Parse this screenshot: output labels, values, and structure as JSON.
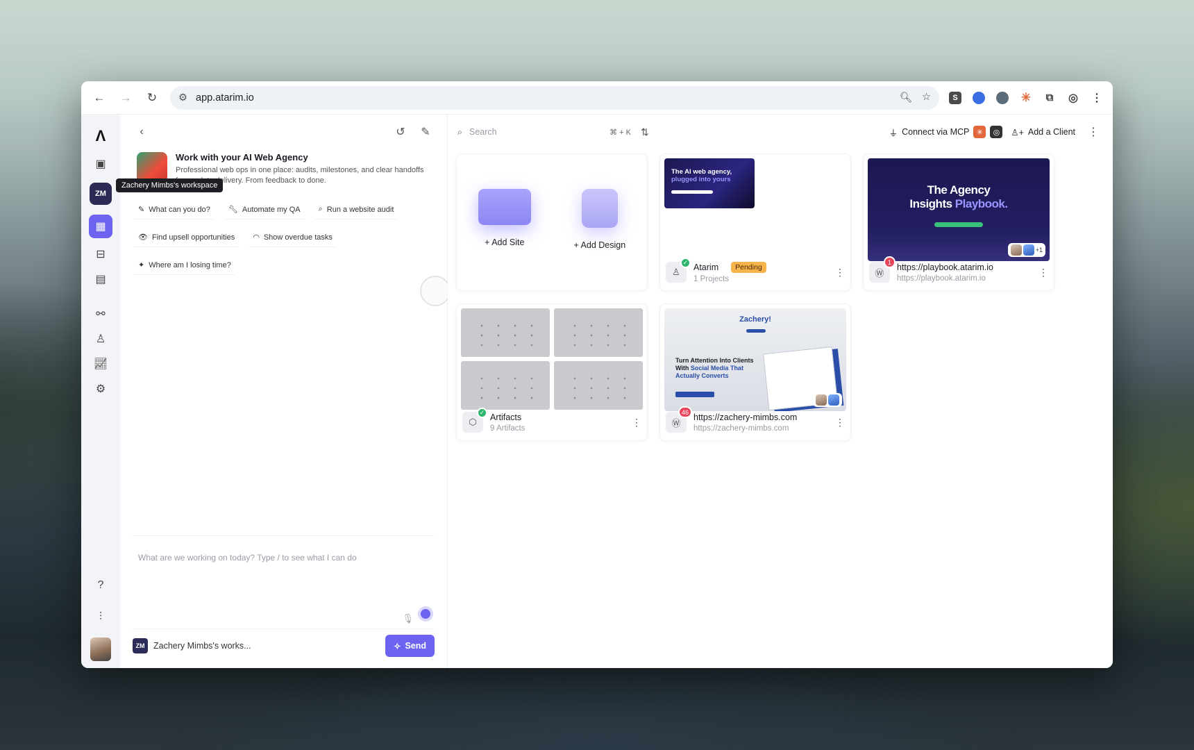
{
  "browser": {
    "url": "app.atarim.io",
    "extensions": [
      {
        "icon": "s-extension-icon",
        "label": "S",
        "color": "#4a4a4a"
      },
      {
        "icon": "blue-circle-extension-icon",
        "label": "",
        "color": "#3b6ee0"
      },
      {
        "icon": "shield-extension-icon",
        "label": "",
        "color": "#5a6b7a"
      },
      {
        "icon": "asterisk-extension-icon",
        "label": "",
        "color": "#e2683c"
      }
    ]
  },
  "rail": {
    "logo": "Λ",
    "workspace_initials": "ZM",
    "workspace_tooltip": "Zachery Mimbs's workspace"
  },
  "chat": {
    "intro_title": "Work with your AI Web Agency",
    "intro_sub_1": "Professional web ops in one place: audits, milestones, and clear handoffs",
    "intro_sub_2": "from ask to delivery. From feedback to done.",
    "suggestions": [
      "What can you do?",
      "Automate my QA",
      "Run a website audit",
      "Find upsell opportunities",
      "Show overdue tasks",
      "Where am I losing time?"
    ],
    "composer_placeholder": "What are we working on today? Type / to see what I can do",
    "workspace_chip": "ZM",
    "workspace_name": "Zachery Mimbs's works...",
    "send_label": "Send"
  },
  "topbar": {
    "search_placeholder": "Search",
    "search_shortcut": "⌘ + K",
    "connect_mcp": "Connect via MCP",
    "add_client": "Add a Client"
  },
  "cards": {
    "add_site": "Add Site",
    "add_design": "Add Design",
    "atarim": {
      "title": "Atarim",
      "status": "Pending",
      "subtitle": "1 Projects",
      "thumb_line_1": "The AI web agency,",
      "thumb_line_2": "plugged into yours"
    },
    "playbook": {
      "title": "https://playbook.atarim.io",
      "subtitle": "https://playbook.atarim.io",
      "badge": "1",
      "thumb_title_1": "The Agency",
      "thumb_title_2a": "Insights ",
      "thumb_title_2b": "Playbook.",
      "extra_count": "+1"
    },
    "artifacts": {
      "title": "Artifacts",
      "subtitle": "9 Artifacts"
    },
    "zachery": {
      "title": "https://zachery-mimbs.com",
      "subtitle": "https://zachery-mimbs.com",
      "badge": "46",
      "thumb_hi": "Zachery!",
      "thumb_head_1": "Turn Attention Into Clients With ",
      "thumb_head_2": "Social Media That Actually Converts"
    }
  },
  "colors": {
    "accent": "#6d63f0",
    "pending": "#f7b44a",
    "badge": "#e8455b",
    "check": "#2db46d"
  }
}
